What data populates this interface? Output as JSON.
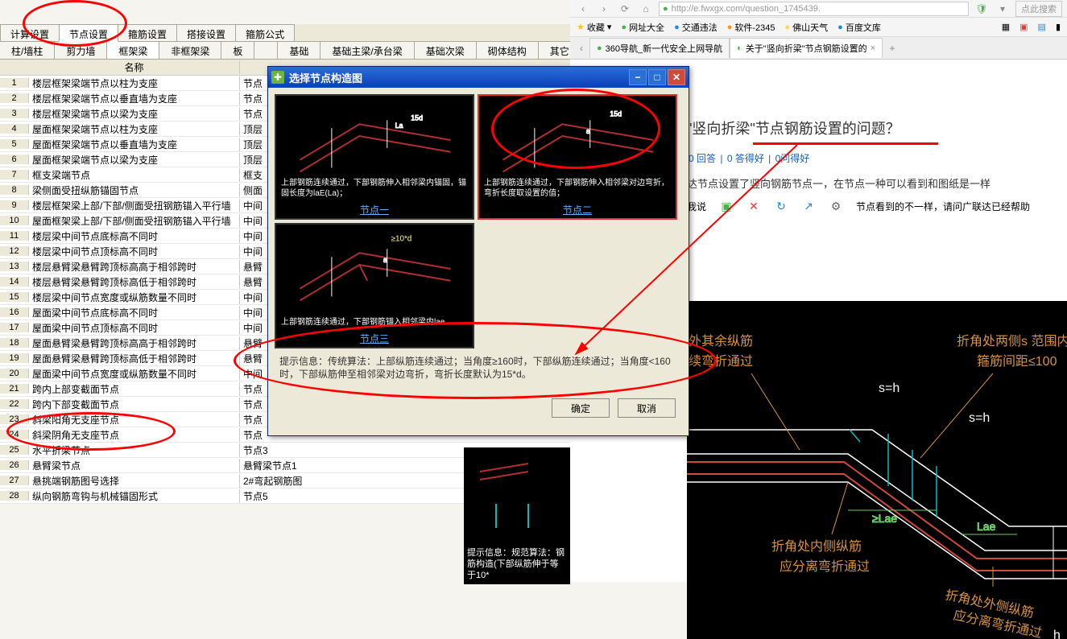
{
  "main_tabs": [
    "计算设置",
    "节点设置",
    "箍筋设置",
    "搭接设置",
    "箍筋公式"
  ],
  "main_tab_active": 1,
  "sub_tabs": [
    "柱/墙柱",
    "剪力墙",
    "框架梁",
    "非框架梁",
    "板",
    "",
    "基础",
    "基础主梁/承台梁",
    "基础次梁",
    "砌体结构",
    "其它"
  ],
  "sub_tab_active": 2,
  "grid_header": {
    "name": "名称"
  },
  "grid_rows": [
    {
      "n": 1,
      "name": "楼层框架梁端节点以柱为支座",
      "v": "节点"
    },
    {
      "n": 2,
      "name": "楼层框架梁端节点以垂直墙为支座",
      "v": "节点"
    },
    {
      "n": 3,
      "name": "楼层框架梁端节点以梁为支座",
      "v": "节点"
    },
    {
      "n": 4,
      "name": "屋面框架梁端节点以柱为支座",
      "v": "顶层"
    },
    {
      "n": 5,
      "name": "屋面框架梁端节点以垂直墙为支座",
      "v": "顶层"
    },
    {
      "n": 6,
      "name": "屋面框架梁端节点以梁为支座",
      "v": "顶层"
    },
    {
      "n": 7,
      "name": "框支梁端节点",
      "v": "框支"
    },
    {
      "n": 8,
      "name": "梁侧面受扭纵筋锚固节点",
      "v": "侧面"
    },
    {
      "n": 9,
      "name": "楼层框架梁上部/下部/侧面受扭钢筋锚入平行墙",
      "v": "中间"
    },
    {
      "n": 10,
      "name": "屋面框架梁上部/下部/侧面受扭钢筋锚入平行墙",
      "v": "中间"
    },
    {
      "n": 11,
      "name": "楼层梁中间节点底标高不同时",
      "v": "中间"
    },
    {
      "n": 12,
      "name": "楼层梁中间节点顶标高不同时",
      "v": "中间"
    },
    {
      "n": 13,
      "name": "楼层悬臂梁悬臂跨顶标高高于相邻跨时",
      "v": "悬臂"
    },
    {
      "n": 14,
      "name": "楼层悬臂梁悬臂跨顶标高低于相邻跨时",
      "v": "悬臂"
    },
    {
      "n": 15,
      "name": "楼层梁中间节点宽度或纵筋数量不同时",
      "v": "中间"
    },
    {
      "n": 16,
      "name": "屋面梁中间节点底标高不同时",
      "v": "中间"
    },
    {
      "n": 17,
      "name": "屋面梁中间节点顶标高不同时",
      "v": "中间"
    },
    {
      "n": 18,
      "name": "屋面悬臂梁悬臂跨顶标高高于相邻跨时",
      "v": "悬臂"
    },
    {
      "n": 19,
      "name": "屋面悬臂梁悬臂跨顶标高低于相邻跨时",
      "v": "悬臂"
    },
    {
      "n": 20,
      "name": "屋面梁中间节点宽度或纵筋数量不同时",
      "v": "中间"
    },
    {
      "n": 21,
      "name": "跨内上部变截面节点",
      "v": "节点"
    },
    {
      "n": 22,
      "name": "跨内下部变截面节点",
      "v": "节点"
    },
    {
      "n": 23,
      "name": "斜梁阳角无支座节点",
      "v": "节点"
    },
    {
      "n": 24,
      "name": "斜梁阴角无支座节点",
      "v": "节点"
    },
    {
      "n": 25,
      "name": "水平折梁节点",
      "v": "节点3"
    },
    {
      "n": 26,
      "name": "悬臂梁节点",
      "v": "悬臂梁节点1"
    },
    {
      "n": 27,
      "name": "悬挑端钢筋图号选择",
      "v": "2#弯起钢筋图"
    },
    {
      "n": 28,
      "name": "纵向钢筋弯钩与机械锚固形式",
      "v": "节点5"
    }
  ],
  "dialog": {
    "title": "选择节点构造图",
    "node1": {
      "label": "节点一",
      "desc": "上部钢筋连续通过，下部钢筋伸入相邻梁内锚固，锚固长度为laE(La)；"
    },
    "node2": {
      "label": "节点二",
      "desc": "上部钢筋连续通过，下部钢筋伸入相邻梁对边弯折，弯折长度取设置的值；"
    },
    "node3": {
      "label": "节点三",
      "desc": "上部钢筋连续通过，下部钢筋锚入相邻梁内lae",
      "dim": "≥10*d"
    },
    "hint_label": "提示信息：",
    "hint": "传统算法：上部纵筋连续通过；当角度≥160时，下部纵筋连续通过；当角度<160时，下部纵筋伸至相邻梁对边弯折，弯折长度默认为15*d。",
    "ok": "确定",
    "cancel": "取消"
  },
  "preview": {
    "hint_label": "提示信息：",
    "hint": "规范算法：钢筋构造(下部纵筋伸于等于10*"
  },
  "browser": {
    "addr": "http://e.fwxgx.com/question_1745439.",
    "addr_placeholder": "点此搜索",
    "fav_label": "收藏",
    "favs": [
      "网址大全",
      "交通违法",
      "软件-2345",
      "佛山天气",
      "百度文库"
    ],
    "tab1": "360导航_新一代安全上网导航",
    "tab2": "关于\"竖向折梁\"节点钢筋设置的",
    "page_title": "\"竖向折梁\"节点钢筋设置的问题？",
    "stats": {
      "answers": "0 回答",
      "good": "0 答得好",
      "ask": "0问得好"
    },
    "para1": "达节点设置了竖向钢筋节点一，在节点一种可以看到和图纸是一样",
    "para2": "节点看到的不一样，请问广联达已经帮助",
    "para_pre": "我说",
    "diagram_labels": {
      "l1": "外其余纵筋",
      "l2": "续弯折通过",
      "l3": "折角处内侧纵筋",
      "l4": "应分离弯折通过",
      "l5": "折角处两侧s 范围内",
      "l6": "箍筋间距≤100",
      "l7": "s=h",
      "l8": "≥Lae",
      "l9": "Lae",
      "l10": "折角处外侧纵筋",
      "l11": "应分离弯折通过",
      "l12": "h"
    }
  }
}
